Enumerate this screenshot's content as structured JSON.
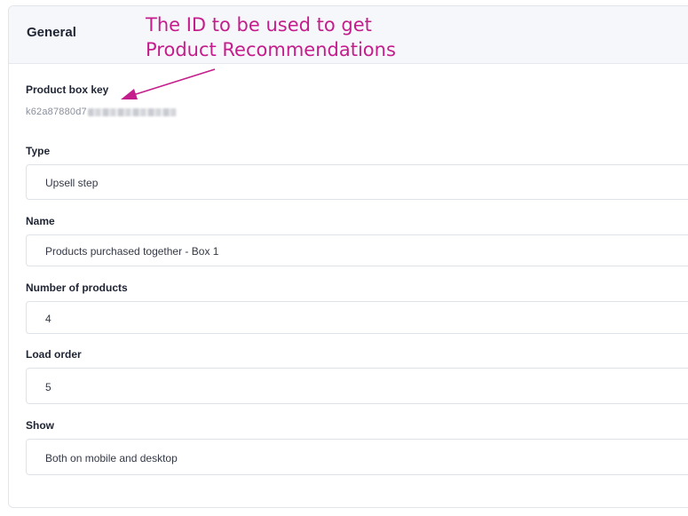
{
  "panel": {
    "title": "General"
  },
  "annotation": {
    "line1": "The ID to be used to get",
    "line2": "Product Recommendations",
    "color": "#c41d8c"
  },
  "product_box_key": {
    "label": "Product box key",
    "value_prefix": "k62a87880d7"
  },
  "fields": {
    "type": {
      "label": "Type",
      "value": "Upsell step"
    },
    "name": {
      "label": "Name",
      "value": "Products purchased together - Box 1"
    },
    "number_of_products": {
      "label": "Number of products",
      "value": "4"
    },
    "load_order": {
      "label": "Load order",
      "value": "5"
    },
    "show": {
      "label": "Show",
      "value": "Both on mobile and desktop"
    }
  }
}
